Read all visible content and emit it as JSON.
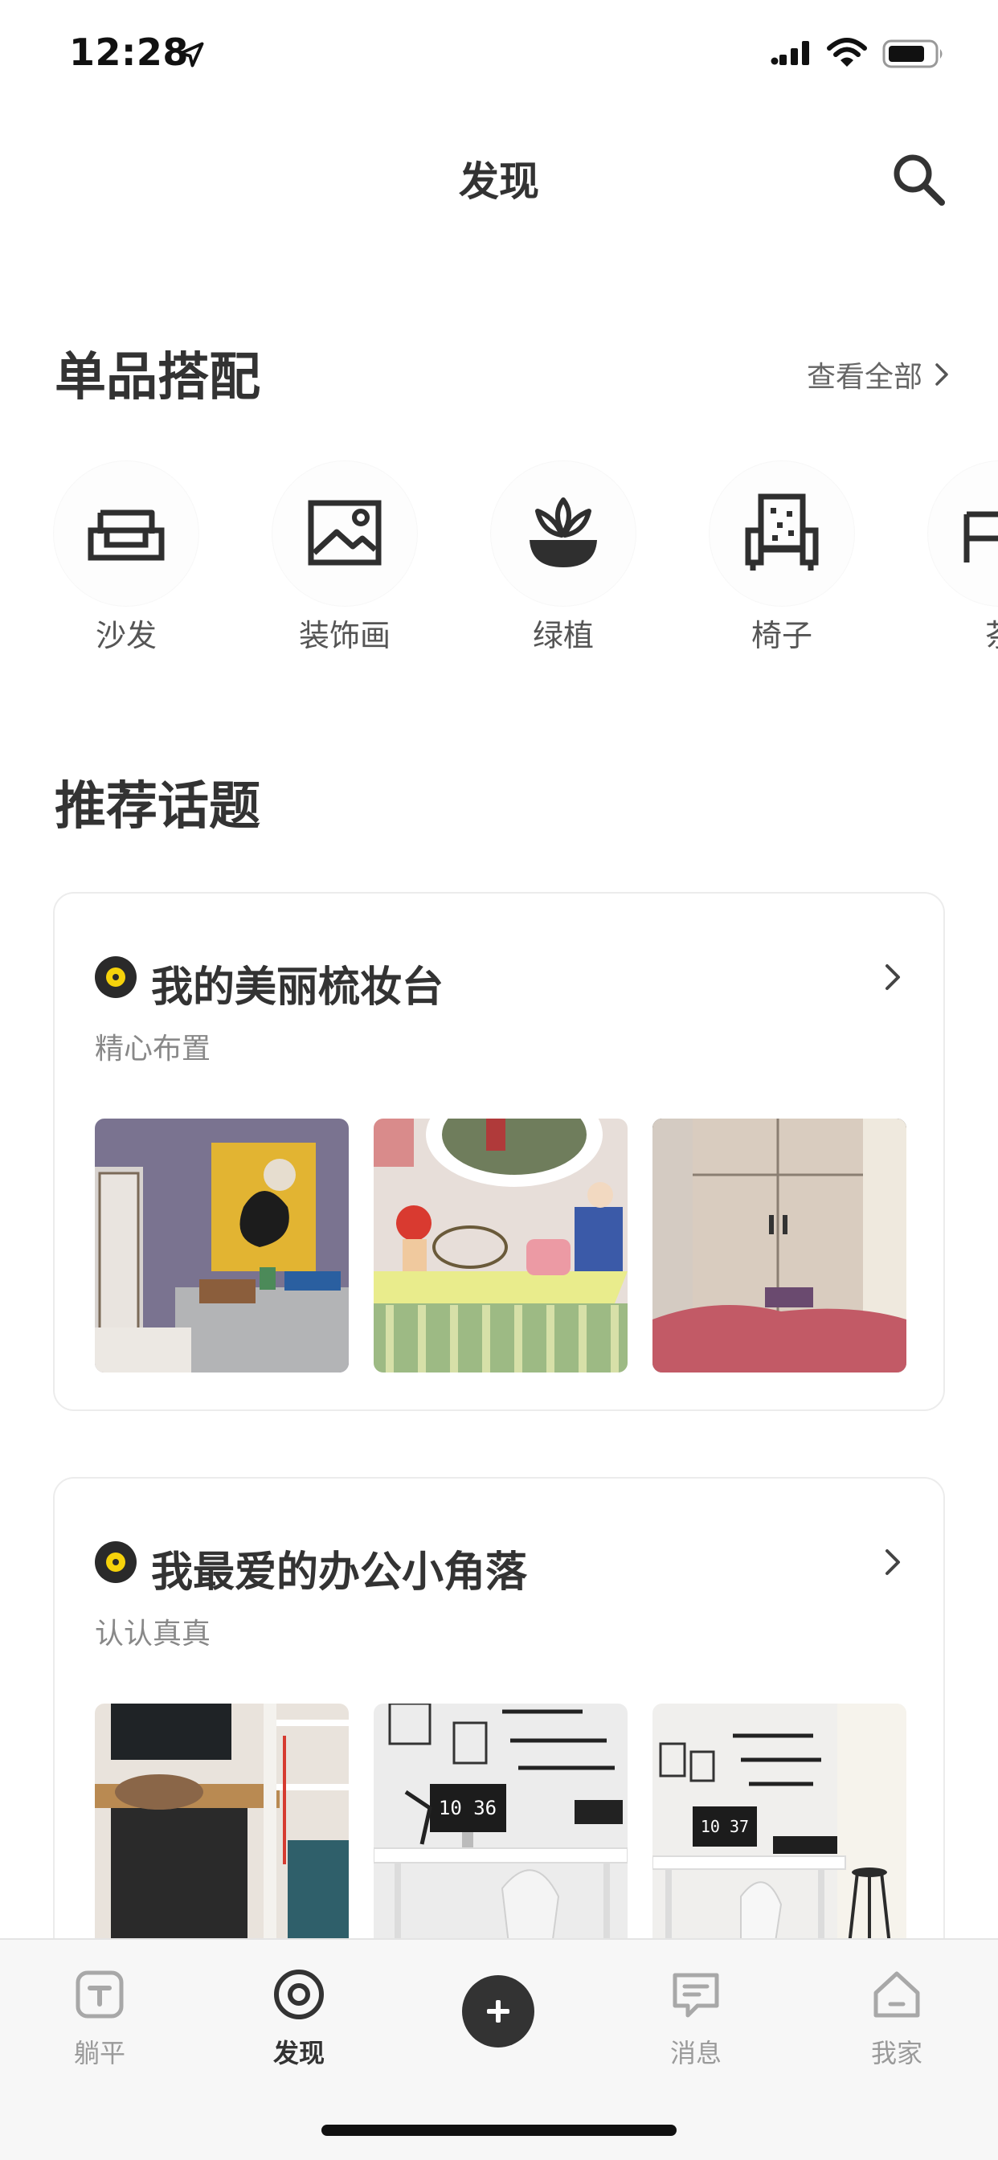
{
  "status_bar": {
    "time": "12:28"
  },
  "nav": {
    "title": "发现"
  },
  "single_items": {
    "title": "单品搭配",
    "see_all": "查看全部",
    "categories": [
      {
        "label": "沙发",
        "icon": "sofa-icon"
      },
      {
        "label": "装饰画",
        "icon": "picture-icon"
      },
      {
        "label": "绿植",
        "icon": "plant-icon"
      },
      {
        "label": "椅子",
        "icon": "chair-icon"
      },
      {
        "label": "茶",
        "icon": "tea-table-icon"
      }
    ]
  },
  "topics": {
    "title": "推荐话题",
    "cards": [
      {
        "title": "我的美丽梳妆台",
        "subtitle": "精心布置"
      },
      {
        "title": "我最爱的办公小角落",
        "subtitle": "认认真真",
        "photo_clocks": [
          "10 36",
          "10 37"
        ]
      }
    ]
  },
  "tabs": [
    {
      "label": "躺平",
      "icon": "tangping-icon"
    },
    {
      "label": "发现",
      "icon": "discover-icon",
      "active": true
    },
    {
      "label": "",
      "icon": "plus-icon"
    },
    {
      "label": "消息",
      "icon": "message-icon"
    },
    {
      "label": "我家",
      "icon": "home-icon"
    }
  ],
  "colors": {
    "accent_yellow": "#f5d20b",
    "dark": "#333333",
    "tab_inactive": "#9a9a9a"
  }
}
